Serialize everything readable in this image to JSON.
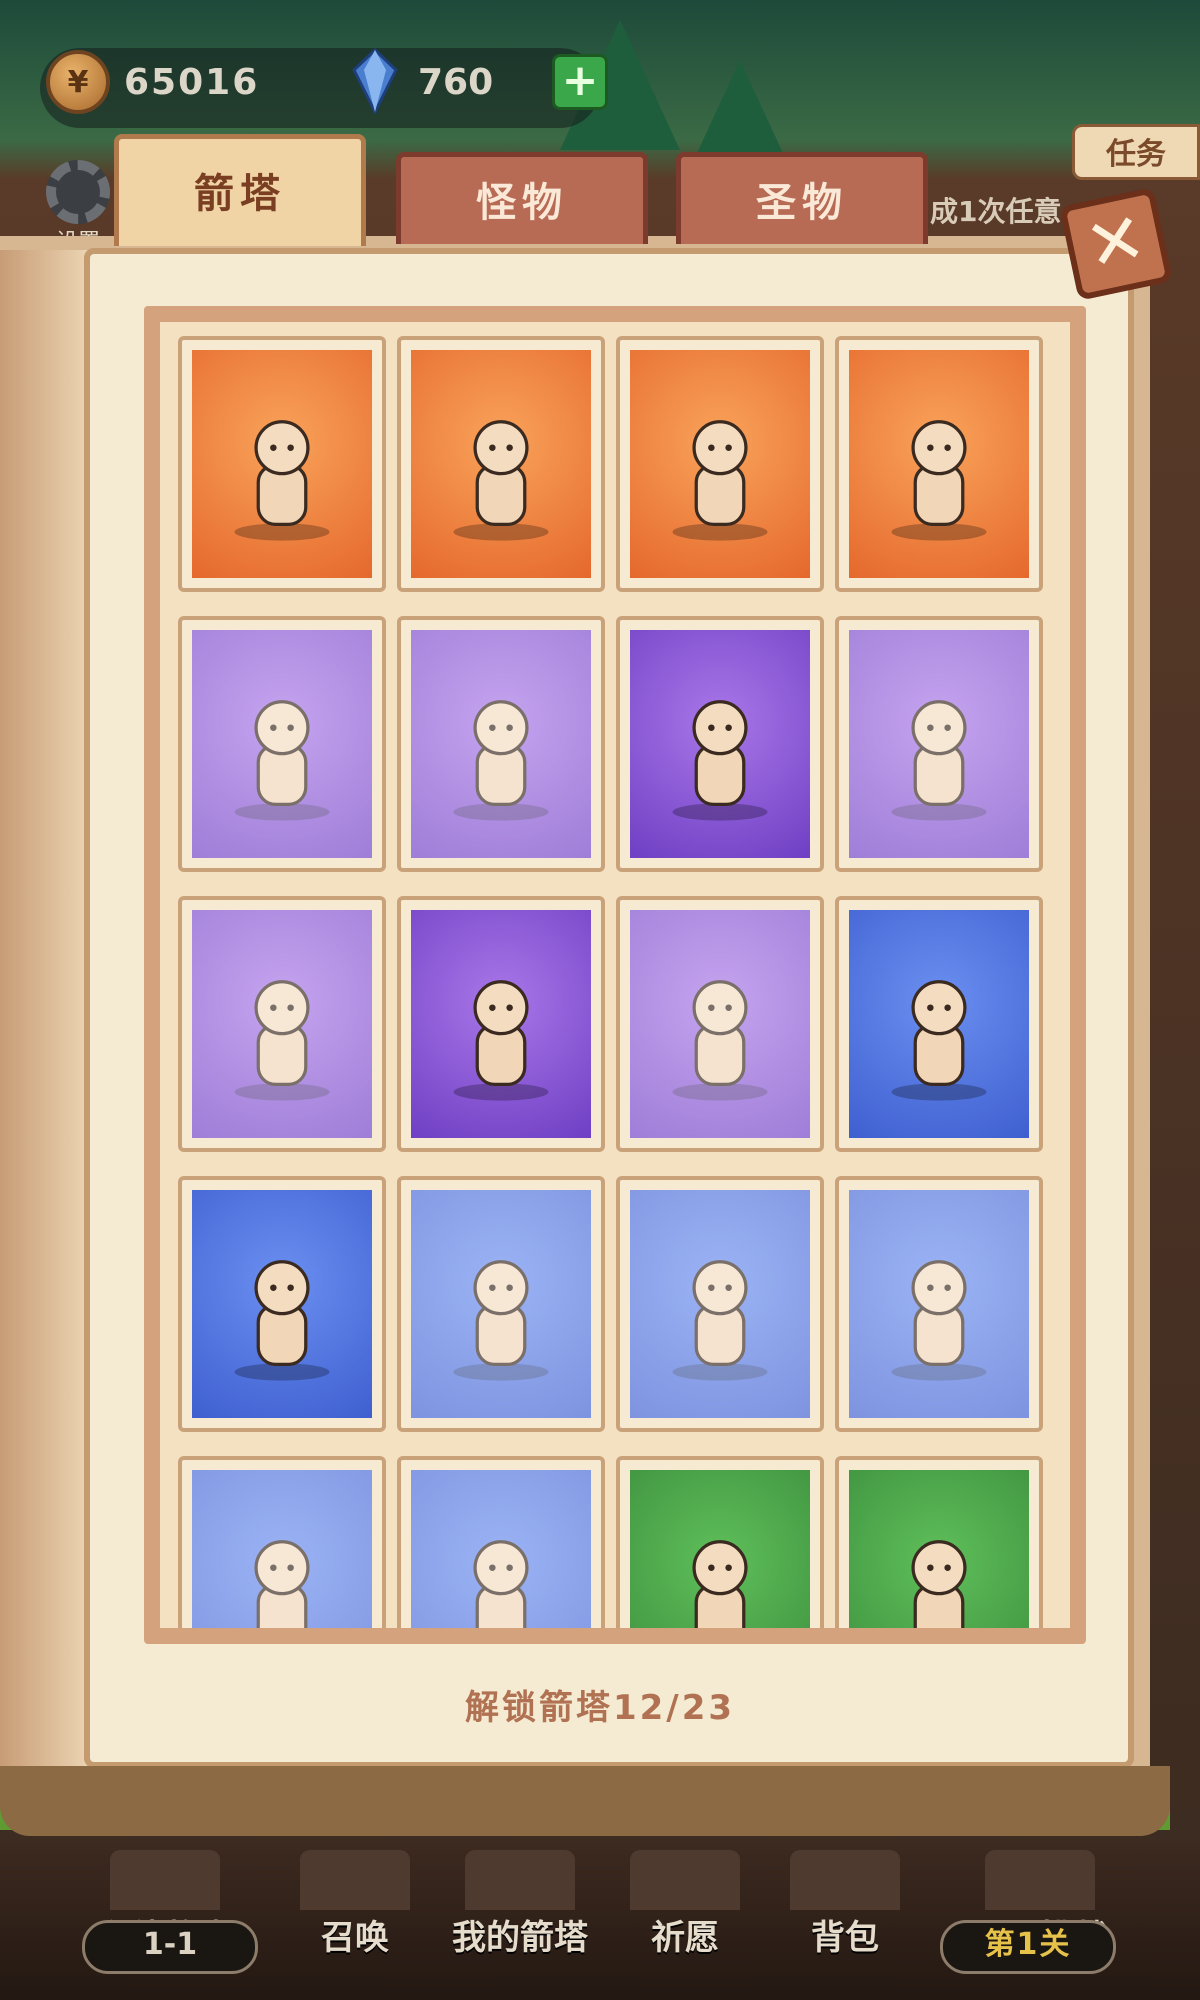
{
  "resources": {
    "gold": "65016",
    "gems": "760"
  },
  "settings_label": "设置",
  "task": {
    "label": "任务",
    "text": "成1次任意"
  },
  "tabs": [
    {
      "label": "箭塔",
      "active": true
    },
    {
      "label": "怪物",
      "active": false
    },
    {
      "label": "圣物",
      "active": false
    }
  ],
  "close_label": "✕",
  "cards": [
    {
      "tint": "orange",
      "locked": false,
      "figure": "red-hair-brawler"
    },
    {
      "tint": "orange",
      "locked": false,
      "figure": "flame-spirit"
    },
    {
      "tint": "orange",
      "locked": false,
      "figure": "star-mage"
    },
    {
      "tint": "orange",
      "locked": false,
      "figure": "medusa"
    },
    {
      "tint": "purple",
      "locked": true,
      "figure": "cat-sniper"
    },
    {
      "tint": "purple",
      "locked": true,
      "figure": "ice-dragon"
    },
    {
      "tint": "purple",
      "locked": false,
      "figure": "spartan"
    },
    {
      "tint": "purple",
      "locked": true,
      "figure": "tribal-totem"
    },
    {
      "tint": "purple",
      "locked": true,
      "figure": "crystal-princess"
    },
    {
      "tint": "purple",
      "locked": false,
      "figure": "lotus-fairy"
    },
    {
      "tint": "purple",
      "locked": true,
      "figure": "harpy"
    },
    {
      "tint": "blue",
      "locked": false,
      "figure": "dwarf-gunner"
    },
    {
      "tint": "blue",
      "locked": false,
      "figure": "pirate-girl"
    },
    {
      "tint": "blue",
      "locked": true,
      "figure": "shadow-guardian"
    },
    {
      "tint": "blue",
      "locked": true,
      "figure": "knight"
    },
    {
      "tint": "blue",
      "locked": true,
      "figure": "elf-harpist"
    },
    {
      "tint": "blue",
      "locked": true,
      "figure": "wizard"
    },
    {
      "tint": "blue",
      "locked": true,
      "figure": "horned-warrior"
    },
    {
      "tint": "green",
      "locked": false,
      "figure": "ape-rock-thrower"
    },
    {
      "tint": "green",
      "locked": false,
      "figure": "ninja"
    }
  ],
  "unlock_text": "解锁箭塔12/23",
  "nav": [
    {
      "label": "主线故事",
      "sub": "1-1"
    },
    {
      "label": "召唤"
    },
    {
      "label": "我的箭塔"
    },
    {
      "label": "祈愿"
    },
    {
      "label": "背包"
    },
    {
      "label": "无尽挑战",
      "sub": "第1关"
    }
  ],
  "colors": {
    "orange": "#e5682d",
    "purple": "#6f3fc4",
    "blue": "#3f5fd0",
    "green": "#3b8d3c"
  }
}
